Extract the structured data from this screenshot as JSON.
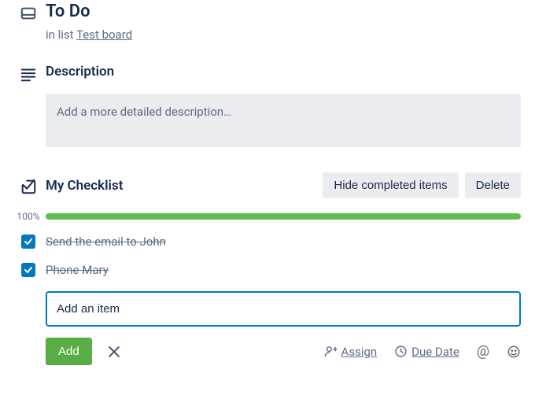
{
  "card": {
    "title": "To Do",
    "in_list_prefix": "in list ",
    "list_name": "Test board"
  },
  "description": {
    "heading": "Description",
    "placeholder": "Add a more detailed description…"
  },
  "checklist": {
    "heading": "My Checklist",
    "hide_completed_label": "Hide completed items",
    "delete_label": "Delete",
    "progress_pct": "100%",
    "progress_value": 100,
    "items": [
      {
        "label": "Send the email to John",
        "checked": true
      },
      {
        "label": "Phone Mary",
        "checked": true
      }
    ],
    "add_item_placeholder": "Add an item",
    "add_button_label": "Add",
    "assign_label": "Assign",
    "due_date_label": "Due Date"
  },
  "colors": {
    "progress_fill": "#61bd4f",
    "checkbox_bg": "#0079bf",
    "add_button_bg": "#5aac44",
    "input_border": "#0079bf"
  }
}
